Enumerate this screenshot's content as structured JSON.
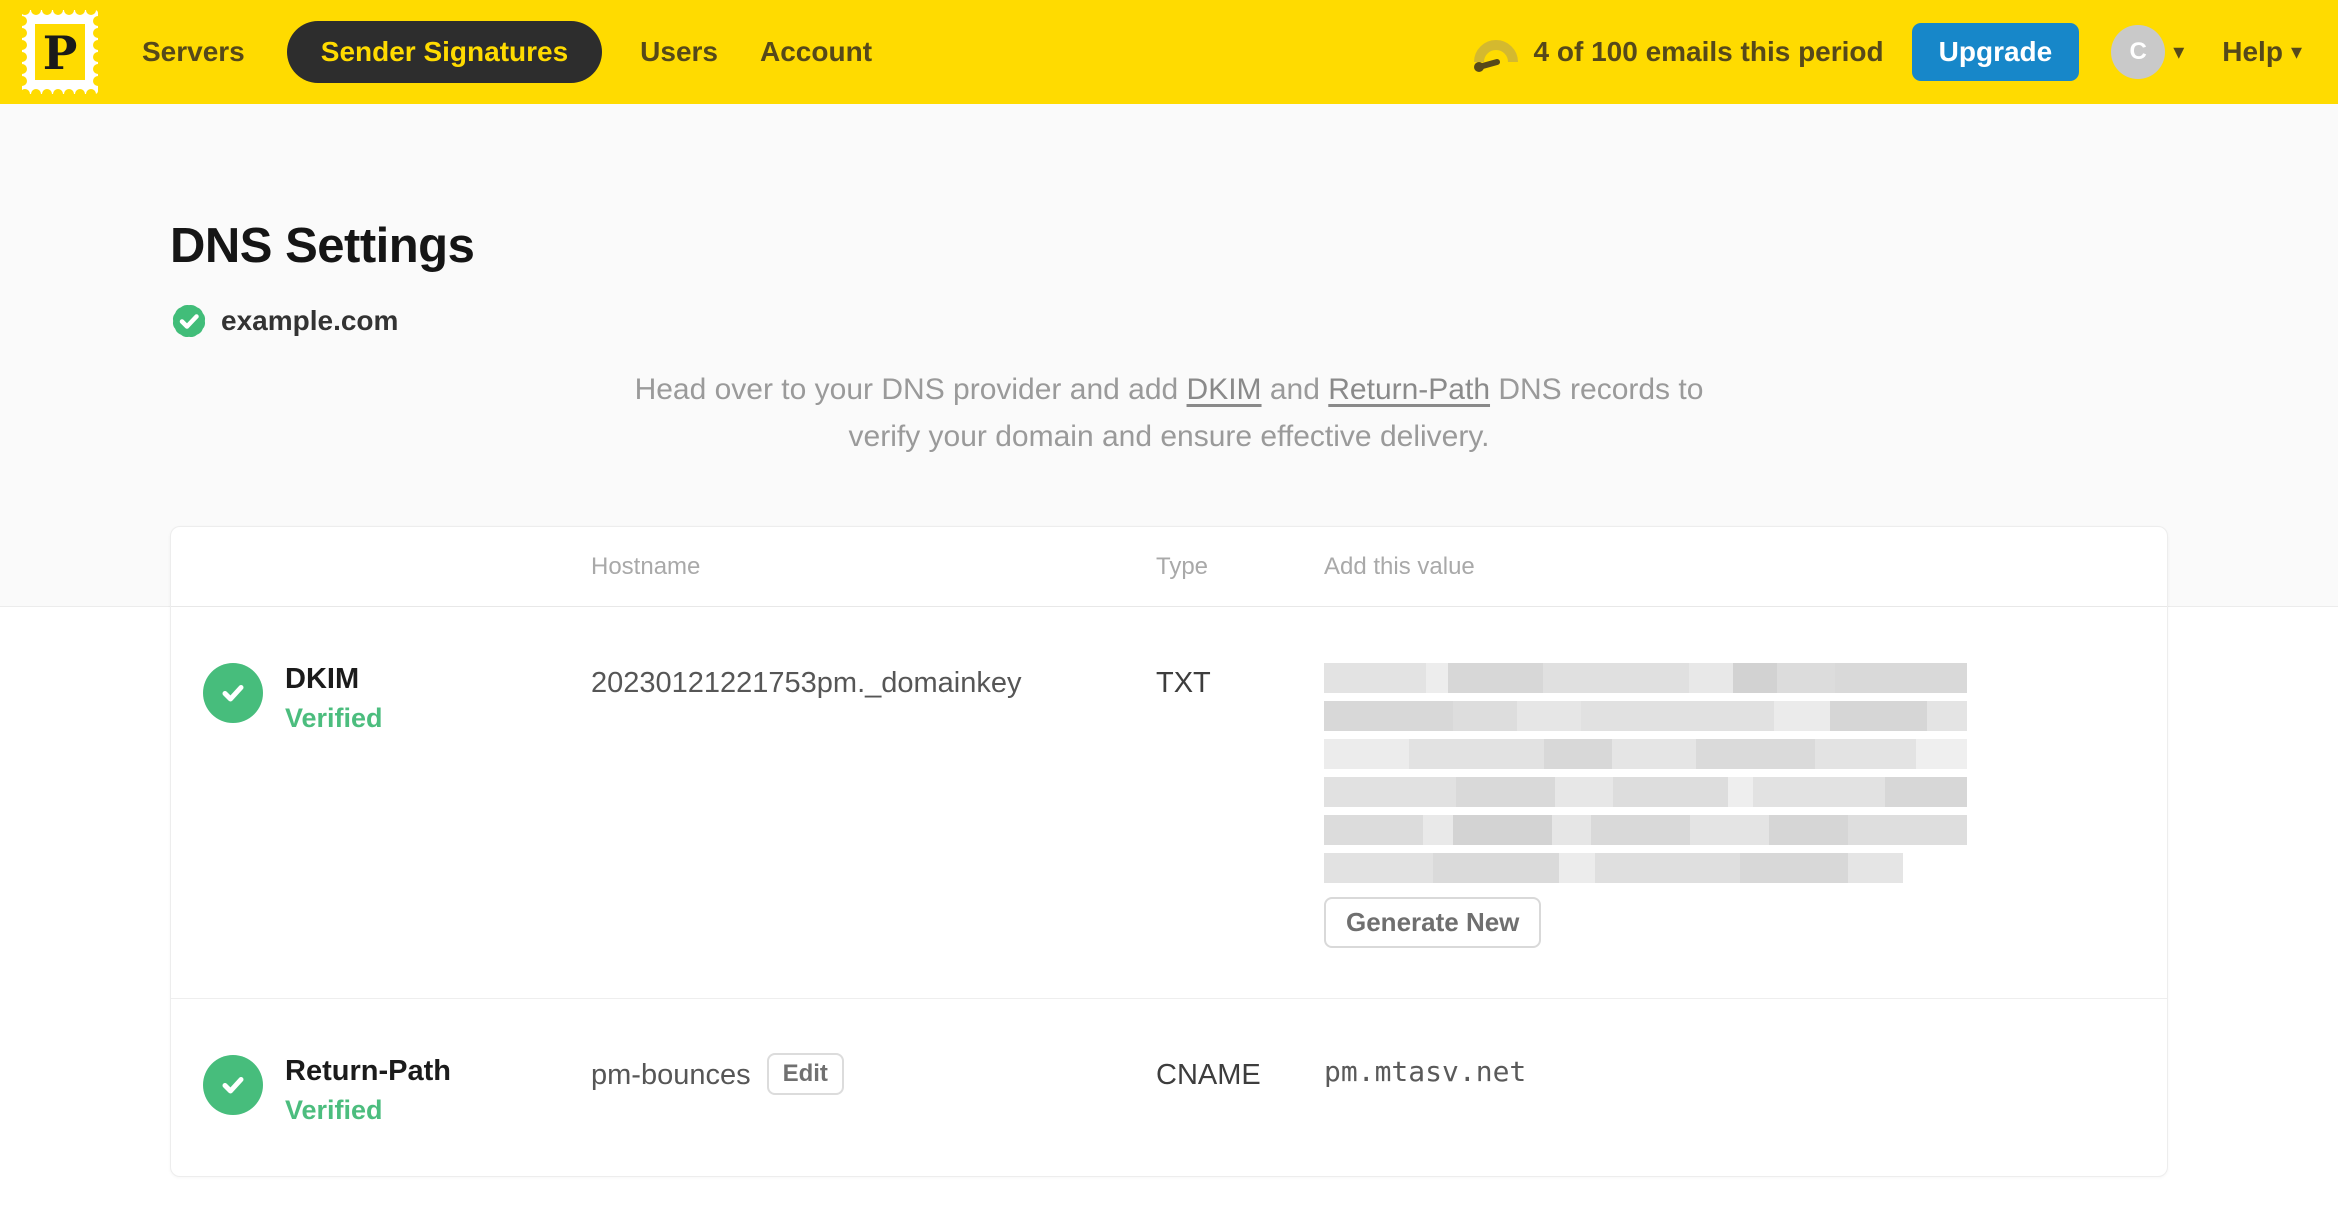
{
  "nav": {
    "items": [
      {
        "label": "Servers",
        "active": false
      },
      {
        "label": "Sender Signatures",
        "active": true
      },
      {
        "label": "Users",
        "active": false
      },
      {
        "label": "Account",
        "active": false
      }
    ],
    "usage_text": "4 of 100 emails this period",
    "upgrade_label": "Upgrade",
    "avatar_initial": "C",
    "help_label": "Help"
  },
  "icons": {
    "logo": "postmark-stamp-icon",
    "logo_letter": "P",
    "usage": "gauge-icon",
    "domain_badge": "verified-seal-icon",
    "row_status": "check-circle-icon"
  },
  "colors": {
    "brand_yellow": "#FFDB00",
    "nav_text": "#56491A",
    "upgrade_blue": "#1787C9",
    "verified_green": "#47BD7C",
    "page_bg": "#FAFAFA"
  },
  "page": {
    "title": "DNS Settings",
    "domain": "example.com",
    "desc": {
      "p1": "Head over to your DNS provider and add ",
      "link1": "DKIM",
      "p2": " and ",
      "link2": "Return-Path",
      "p3": " DNS records to",
      "p4": "verify your domain and ensure effective delivery."
    }
  },
  "table": {
    "headers": {
      "hostname": "Hostname",
      "type": "Type",
      "value": "Add this value"
    },
    "rows": [
      {
        "name": "DKIM",
        "status": "Verified",
        "hostname": "20230121221753pm._domainkey",
        "type": "TXT",
        "value": "(redacted)",
        "action": "Generate New"
      },
      {
        "name": "Return-Path",
        "status": "Verified",
        "hostname": "pm-bounces",
        "hostname_action": "Edit",
        "type": "CNAME",
        "value": "pm.mtasv.net"
      }
    ]
  },
  "redacted_bars": [
    {
      "width_pct": 100,
      "segments": [
        [
          14,
          "#e3e3e3"
        ],
        [
          3,
          "#ededed"
        ],
        [
          13,
          "#d7d7d7"
        ],
        [
          20,
          "#e0e0e0"
        ],
        [
          6,
          "#e8e8e8"
        ],
        [
          6,
          "#d2d2d2"
        ],
        [
          8,
          "#dcdcdc"
        ],
        [
          18,
          "#d9d9d9"
        ]
      ]
    },
    {
      "width_pct": 100,
      "segments": [
        [
          16,
          "#d8d8d8"
        ],
        [
          8,
          "#dddddd"
        ],
        [
          8,
          "#e6e6e6"
        ],
        [
          24,
          "#e1e1e1"
        ],
        [
          7,
          "#ebebeb"
        ],
        [
          12,
          "#d6d6d6"
        ],
        [
          5,
          "#e4e4e4"
        ]
      ]
    },
    {
      "width_pct": 100,
      "segments": [
        [
          10,
          "#ececec"
        ],
        [
          16,
          "#e2e2e2"
        ],
        [
          8,
          "#d8d8d8"
        ],
        [
          10,
          "#e5e5e5"
        ],
        [
          14,
          "#dadada"
        ],
        [
          12,
          "#e3e3e3"
        ],
        [
          6,
          "#efefef"
        ]
      ]
    },
    {
      "width_pct": 100,
      "segments": [
        [
          16,
          "#e1e1e1"
        ],
        [
          12,
          "#d9d9d9"
        ],
        [
          7,
          "#e7e7e7"
        ],
        [
          14,
          "#dddddd"
        ],
        [
          3,
          "#eeeeee"
        ],
        [
          16,
          "#e2e2e2"
        ],
        [
          10,
          "#d7d7d7"
        ]
      ]
    },
    {
      "width_pct": 100,
      "segments": [
        [
          10,
          "#dcdcdc"
        ],
        [
          3,
          "#e9e9e9"
        ],
        [
          10,
          "#d3d3d3"
        ],
        [
          4,
          "#e6e6e6"
        ],
        [
          10,
          "#d9d9d9"
        ],
        [
          8,
          "#e4e4e4"
        ],
        [
          8,
          "#d6d6d6"
        ],
        [
          12,
          "#dedede"
        ]
      ]
    },
    {
      "width_pct": 90,
      "segments": [
        [
          12,
          "#e2e2e2"
        ],
        [
          14,
          "#dadada"
        ],
        [
          4,
          "#ececec"
        ],
        [
          16,
          "#dfdfdf"
        ],
        [
          12,
          "#d8d8d8"
        ],
        [
          6,
          "#e5e5e5"
        ]
      ]
    }
  ]
}
